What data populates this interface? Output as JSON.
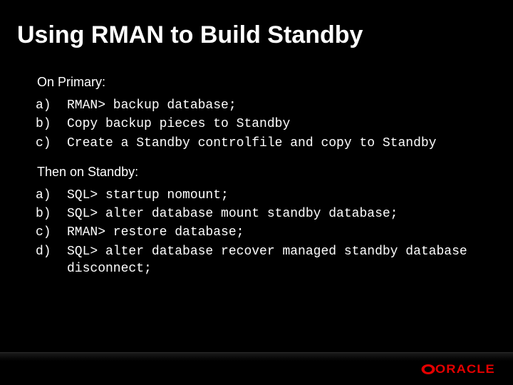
{
  "title": "Using RMAN to Build Standby",
  "sections": [
    {
      "heading": "On Primary:",
      "items": [
        {
          "marker": "a)",
          "text": "RMAN> backup database;"
        },
        {
          "marker": "b)",
          "text": "Copy backup pieces to Standby"
        },
        {
          "marker": "c)",
          "text": "Create a Standby controlfile and copy to Standby"
        }
      ]
    },
    {
      "heading": "Then on Standby:",
      "items": [
        {
          "marker": "a)",
          "text": "SQL> startup nomount;"
        },
        {
          "marker": "b)",
          "text": "SQL> alter database mount standby database;"
        },
        {
          "marker": "c)",
          "text": "RMAN> restore database;"
        },
        {
          "marker": "d)",
          "text": "SQL> alter database recover managed standby database disconnect;"
        }
      ]
    }
  ],
  "logo": {
    "text": "ORACLE",
    "color": "#e40000"
  }
}
